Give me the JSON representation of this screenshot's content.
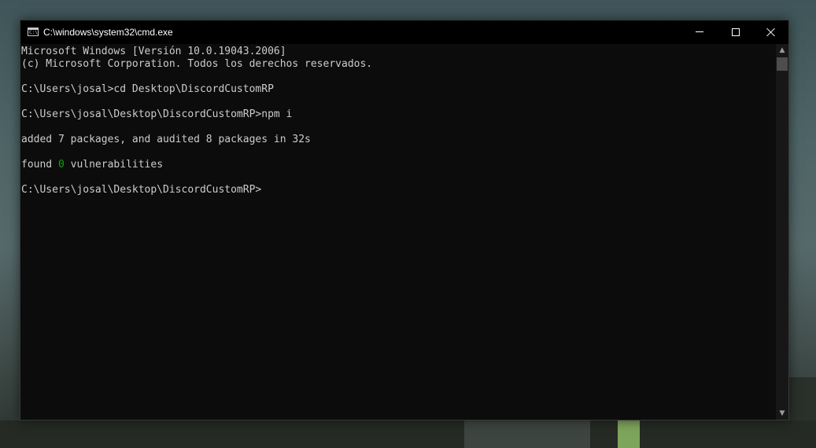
{
  "window": {
    "title": "C:\\windows\\system32\\cmd.exe",
    "app_icon_text": "C:\\",
    "icon": "cmd-console-icon"
  },
  "caption_buttons": {
    "minimize_icon": "minimize-icon",
    "maximize_icon": "maximize-icon",
    "close_icon": "close-icon"
  },
  "console": {
    "line_1": "Microsoft Windows [Versión 10.0.19043.2006]",
    "line_2": "(c) Microsoft Corporation. Todos los derechos reservados.",
    "line_3": "C:\\Users\\josal>cd Desktop\\DiscordCustomRP",
    "line_4": "C:\\Users\\josal\\Desktop\\DiscordCustomRP>npm i",
    "line_5": "added 7 packages, and audited 8 packages in 32s",
    "line_6_prefix": "found ",
    "line_6_count": "0",
    "line_6_suffix": " vulnerabilities",
    "line_7": "C:\\Users\\josal\\Desktop\\DiscordCustomRP>"
  },
  "colors": {
    "console_background": "#0c0c0c",
    "console_text": "#cccccc",
    "highlight_green": "#13a10e",
    "titlebar": "#000000"
  }
}
